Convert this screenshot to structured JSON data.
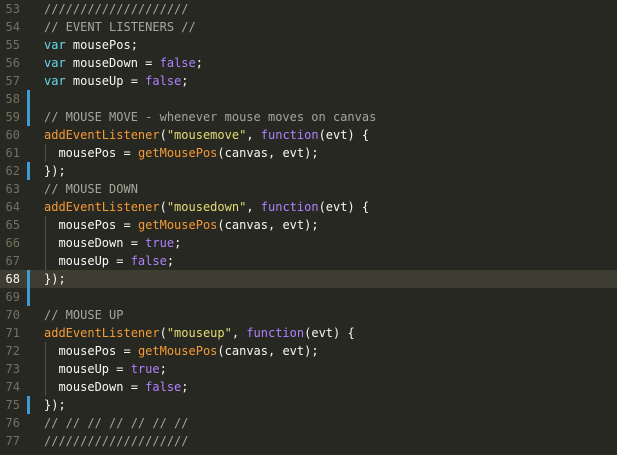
{
  "colors": {
    "background": "#272822",
    "current_line": "#3e3d32",
    "gutter_marker": "#3d9bd6",
    "comment": "#a6a598",
    "keyword": "#66d9ef",
    "identifier": "#f8f8f2",
    "function": "#f49b37",
    "string": "#e6db74",
    "constant": "#ae81ff"
  },
  "editor": {
    "lines": [
      {
        "num": "53",
        "marker": false,
        "current": false,
        "indent": false,
        "tokens": [
          {
            "t": "comment",
            "v": "////////////////////"
          }
        ]
      },
      {
        "num": "54",
        "marker": false,
        "current": false,
        "indent": false,
        "tokens": [
          {
            "t": "comment",
            "v": "// EVENT LISTENERS //"
          }
        ]
      },
      {
        "num": "55",
        "marker": false,
        "current": false,
        "indent": false,
        "tokens": [
          {
            "t": "keyword",
            "v": "var"
          },
          {
            "t": "var",
            "v": " mousePos;"
          }
        ]
      },
      {
        "num": "56",
        "marker": false,
        "current": false,
        "indent": false,
        "tokens": [
          {
            "t": "keyword",
            "v": "var"
          },
          {
            "t": "var",
            "v": " mouseDown "
          },
          {
            "t": "op",
            "v": "= "
          },
          {
            "t": "bool",
            "v": "false"
          },
          {
            "t": "op",
            "v": ";"
          }
        ]
      },
      {
        "num": "57",
        "marker": false,
        "current": false,
        "indent": false,
        "tokens": [
          {
            "t": "keyword",
            "v": "var"
          },
          {
            "t": "var",
            "v": " mouseUp "
          },
          {
            "t": "op",
            "v": "= "
          },
          {
            "t": "bool",
            "v": "false"
          },
          {
            "t": "op",
            "v": ";"
          }
        ]
      },
      {
        "num": "58",
        "marker": true,
        "current": false,
        "indent": false,
        "tokens": []
      },
      {
        "num": "59",
        "marker": true,
        "current": false,
        "indent": false,
        "tokens": [
          {
            "t": "comment",
            "v": "// MOUSE MOVE - whenever mouse moves on canvas"
          }
        ]
      },
      {
        "num": "60",
        "marker": false,
        "current": false,
        "indent": false,
        "tokens": [
          {
            "t": "func",
            "v": "addEventListener"
          },
          {
            "t": "op",
            "v": "("
          },
          {
            "t": "string",
            "v": "\"mousemove\""
          },
          {
            "t": "op",
            "v": ", "
          },
          {
            "t": "kwfunc",
            "v": "function"
          },
          {
            "t": "op",
            "v": "("
          },
          {
            "t": "var",
            "v": "evt"
          },
          {
            "t": "op",
            "v": ") {"
          }
        ]
      },
      {
        "num": "61",
        "marker": false,
        "current": false,
        "indent": true,
        "tokens": [
          {
            "t": "var",
            "v": "  mousePos "
          },
          {
            "t": "op",
            "v": "= "
          },
          {
            "t": "func",
            "v": "getMousePos"
          },
          {
            "t": "op",
            "v": "("
          },
          {
            "t": "var",
            "v": "canvas, evt"
          },
          {
            "t": "op",
            "v": ");"
          }
        ]
      },
      {
        "num": "62",
        "marker": true,
        "current": false,
        "indent": false,
        "tokens": [
          {
            "t": "op",
            "v": "});"
          }
        ]
      },
      {
        "num": "63",
        "marker": false,
        "current": false,
        "indent": false,
        "tokens": [
          {
            "t": "comment",
            "v": "// MOUSE DOWN"
          }
        ]
      },
      {
        "num": "64",
        "marker": false,
        "current": false,
        "indent": false,
        "tokens": [
          {
            "t": "func",
            "v": "addEventListener"
          },
          {
            "t": "op",
            "v": "("
          },
          {
            "t": "string",
            "v": "\"mousedown\""
          },
          {
            "t": "op",
            "v": ", "
          },
          {
            "t": "kwfunc",
            "v": "function"
          },
          {
            "t": "op",
            "v": "("
          },
          {
            "t": "var",
            "v": "evt"
          },
          {
            "t": "op",
            "v": ") {"
          }
        ]
      },
      {
        "num": "65",
        "marker": false,
        "current": false,
        "indent": true,
        "tokens": [
          {
            "t": "var",
            "v": "  mousePos "
          },
          {
            "t": "op",
            "v": "= "
          },
          {
            "t": "func",
            "v": "getMousePos"
          },
          {
            "t": "op",
            "v": "("
          },
          {
            "t": "var",
            "v": "canvas, evt"
          },
          {
            "t": "op",
            "v": ");"
          }
        ]
      },
      {
        "num": "66",
        "marker": false,
        "current": false,
        "indent": true,
        "tokens": [
          {
            "t": "var",
            "v": "  mouseDown "
          },
          {
            "t": "op",
            "v": "= "
          },
          {
            "t": "bool",
            "v": "true"
          },
          {
            "t": "op",
            "v": ";"
          }
        ]
      },
      {
        "num": "67",
        "marker": false,
        "current": false,
        "indent": true,
        "tokens": [
          {
            "t": "var",
            "v": "  mouseUp "
          },
          {
            "t": "op",
            "v": "= "
          },
          {
            "t": "bool",
            "v": "false"
          },
          {
            "t": "op",
            "v": ";"
          }
        ]
      },
      {
        "num": "68",
        "marker": true,
        "current": true,
        "indent": false,
        "tokens": [
          {
            "t": "op",
            "v": "});"
          }
        ]
      },
      {
        "num": "69",
        "marker": true,
        "current": false,
        "indent": false,
        "tokens": []
      },
      {
        "num": "70",
        "marker": false,
        "current": false,
        "indent": false,
        "tokens": [
          {
            "t": "comment",
            "v": "// MOUSE UP"
          }
        ]
      },
      {
        "num": "71",
        "marker": false,
        "current": false,
        "indent": false,
        "tokens": [
          {
            "t": "func",
            "v": "addEventListener"
          },
          {
            "t": "op",
            "v": "("
          },
          {
            "t": "string",
            "v": "\"mouseup\""
          },
          {
            "t": "op",
            "v": ", "
          },
          {
            "t": "kwfunc",
            "v": "function"
          },
          {
            "t": "op",
            "v": "("
          },
          {
            "t": "var",
            "v": "evt"
          },
          {
            "t": "op",
            "v": ") {"
          }
        ]
      },
      {
        "num": "72",
        "marker": false,
        "current": false,
        "indent": true,
        "tokens": [
          {
            "t": "var",
            "v": "  mousePos "
          },
          {
            "t": "op",
            "v": "= "
          },
          {
            "t": "func",
            "v": "getMousePos"
          },
          {
            "t": "op",
            "v": "("
          },
          {
            "t": "var",
            "v": "canvas, evt"
          },
          {
            "t": "op",
            "v": ");"
          }
        ]
      },
      {
        "num": "73",
        "marker": false,
        "current": false,
        "indent": true,
        "tokens": [
          {
            "t": "var",
            "v": "  mouseUp "
          },
          {
            "t": "op",
            "v": "= "
          },
          {
            "t": "bool",
            "v": "true"
          },
          {
            "t": "op",
            "v": ";"
          }
        ]
      },
      {
        "num": "74",
        "marker": false,
        "current": false,
        "indent": true,
        "tokens": [
          {
            "t": "var",
            "v": "  mouseDown "
          },
          {
            "t": "op",
            "v": "= "
          },
          {
            "t": "bool",
            "v": "false"
          },
          {
            "t": "op",
            "v": ";"
          }
        ]
      },
      {
        "num": "75",
        "marker": true,
        "current": false,
        "indent": false,
        "tokens": [
          {
            "t": "op",
            "v": "});"
          }
        ]
      },
      {
        "num": "76",
        "marker": false,
        "current": false,
        "indent": false,
        "tokens": [
          {
            "t": "comment",
            "v": "// // // // // // //"
          }
        ]
      },
      {
        "num": "77",
        "marker": false,
        "current": false,
        "indent": false,
        "tokens": [
          {
            "t": "comment",
            "v": "////////////////////"
          }
        ]
      }
    ]
  }
}
